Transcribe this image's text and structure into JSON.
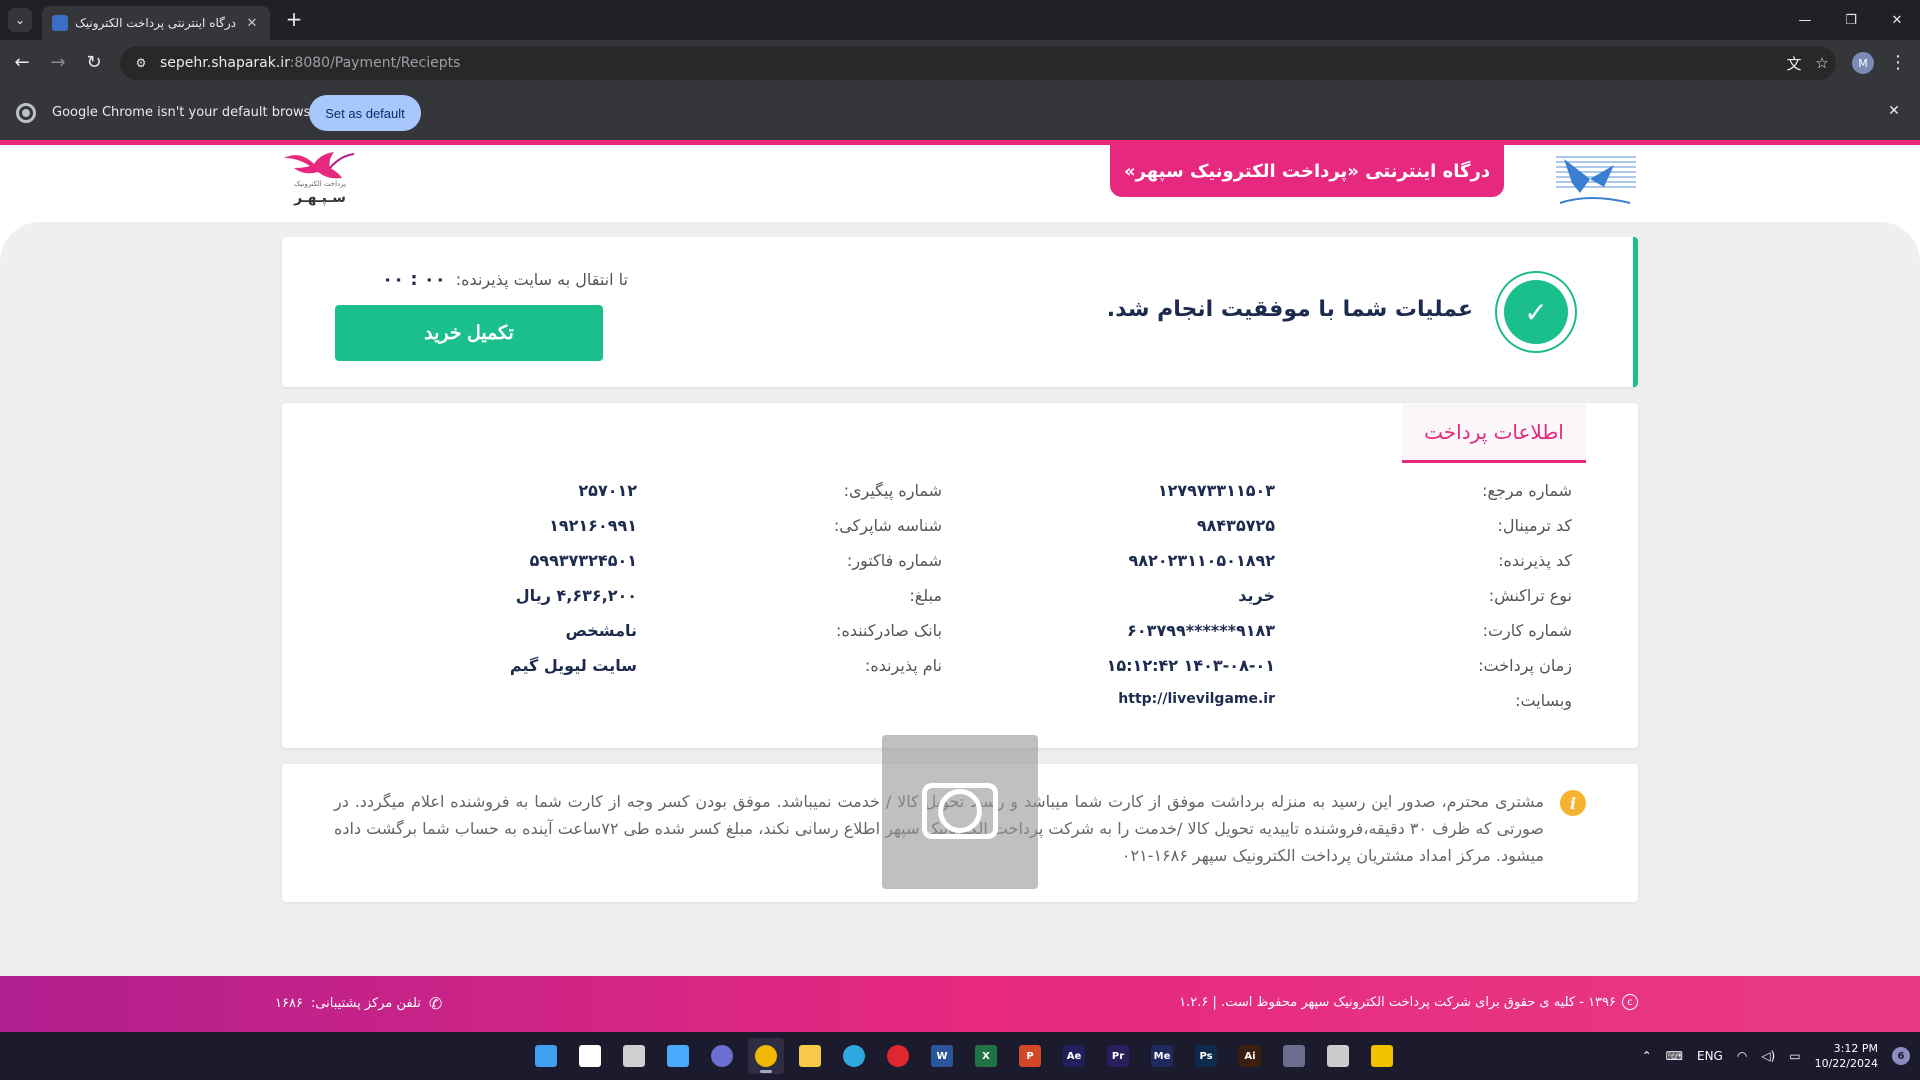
{
  "browser": {
    "tab_title": "درگاه اینترنتی پرداخت الکترونیک سپهر",
    "url_host": "sepehr.shaparak.ir",
    "url_path": ":8080/Payment/Reciepts",
    "profile_initial": "M",
    "infobar_text": "Google Chrome isn't your default browser",
    "infobar_button": "Set as default"
  },
  "header": {
    "title": "درگاه اینترنتی «پرداخت الکترونیک سپهر»",
    "sepehr_small": "پرداخت الکترونیک",
    "sepehr_big": "سـپـهـر"
  },
  "success": {
    "message": "عملیات شما با موفقیت انجام شد.",
    "redirect_label": "تا انتقال به سایت پذیرنده:",
    "timer": "۰۰ : ۰۰",
    "complete_button": "تکمیل خرید"
  },
  "payment_info": {
    "tab_label": "اطلاعات پرداخت",
    "right_column": [
      {
        "label": "شماره مرجع:",
        "value": "۱۲۷۹۷۳۳۱۱۵۰۳"
      },
      {
        "label": "کد ترمینال:",
        "value": "۹۸۴۳۵۷۲۵"
      },
      {
        "label": "کد پذیرنده:",
        "value": "۹۸۲۰۲۳۱۱۰۵۰۱۸۹۲"
      },
      {
        "label": "نوع تراکنش:",
        "value": "خرید"
      },
      {
        "label": "شماره کارت:",
        "value": "۶۰۳۷۹۹******۹۱۸۳"
      },
      {
        "label": "زمان پرداخت:",
        "value": "۱۴۰۳-۰۸-۰۱ ۱۵:۱۲:۴۲"
      },
      {
        "label": "وبسایت:",
        "value": "http://livevilgame.ir"
      }
    ],
    "left_column": [
      {
        "label": "شماره پیگیری:",
        "value": "۲۵۷۰۱۲"
      },
      {
        "label": "شناسه شاپرکی:",
        "value": "۱۹۲۱۶۰۹۹۱"
      },
      {
        "label": "شماره فاکتور:",
        "value": "۵۹۹۳۷۳۲۴۵۰۱"
      },
      {
        "label": "مبلغ:",
        "value": "۴,۶۳۶,۲۰۰ ریال"
      },
      {
        "label": "بانک صادرکننده:",
        "value": "نامشخص"
      },
      {
        "label": "نام پذیرنده:",
        "value": "سایت لیویل گیم"
      }
    ]
  },
  "notice": {
    "text": "مشتری محترم، صدور این رسید به منزله برداشت موفق از کارت شما میباشد و رسید تحویل کالا / خدمت نمیباشد. موفق بودن کسر وجه از کارت شما به فروشنده اعلام میگردد. در صورتی که ظرف ۳۰ دقیقه،فروشنده تاییدیه تحویل کالا /خدمت را به شرکت پرداخت الکترونیک سپهر اطلاع رسانی نکند، مبلغ کسر شده طی ۷۲ساعت آینده به حساب شما برگشت داده میشود. مرکز امداد مشتریان پرداخت الکترونیک سپهر ۱۶۸۶-۰۲۱"
  },
  "footer": {
    "copyright": "۱۳۹۶ - کلیه ی حقوق برای شرکت پرداخت الکترونیک سپهر محفوظ است. | ۱.۲.۶",
    "phone_label": "تلفن مرکز پشتیبانی:",
    "phone_value": "۱۶۸۶"
  },
  "taskbar": {
    "apps": [
      {
        "name": "start",
        "label": "",
        "color": "#3fa0f0"
      },
      {
        "name": "search",
        "label": "",
        "color": "#ffffff"
      },
      {
        "name": "task-view",
        "label": "",
        "color": "#cfcfcf"
      },
      {
        "name": "widgets",
        "label": "",
        "color": "#4aa8ff"
      },
      {
        "name": "teams",
        "label": "",
        "color": "#6b6fd4"
      },
      {
        "name": "chrome",
        "label": "",
        "color": "#f2b705"
      },
      {
        "name": "file-explorer",
        "label": "",
        "color": "#f7c948"
      },
      {
        "name": "edge",
        "label": "",
        "color": "#2ea8e0"
      },
      {
        "name": "opera",
        "label": "",
        "color": "#e0262e"
      },
      {
        "name": "word",
        "label": "W",
        "color": "#2b579a"
      },
      {
        "name": "excel",
        "label": "X",
        "color": "#217346"
      },
      {
        "name": "powerpoint",
        "label": "P",
        "color": "#d24726"
      },
      {
        "name": "after-effects",
        "label": "Ae",
        "color": "#1f1f5c"
      },
      {
        "name": "premiere",
        "label": "Pr",
        "color": "#2a1f5c"
      },
      {
        "name": "media-encoder",
        "label": "Me",
        "color": "#1f2a5c"
      },
      {
        "name": "photoshop",
        "label": "Ps",
        "color": "#0d2a4a"
      },
      {
        "name": "illustrator",
        "label": "Ai",
        "color": "#3a1f0d"
      },
      {
        "name": "vpn",
        "label": "",
        "color": "#6c6c8c"
      },
      {
        "name": "speedometer",
        "label": "",
        "color": "#cccccc"
      },
      {
        "name": "ttv",
        "label": "",
        "color": "#f2c200"
      }
    ],
    "lang": "ENG",
    "time": "3:12 PM",
    "date": "10/22/2024",
    "notifications": "6"
  }
}
